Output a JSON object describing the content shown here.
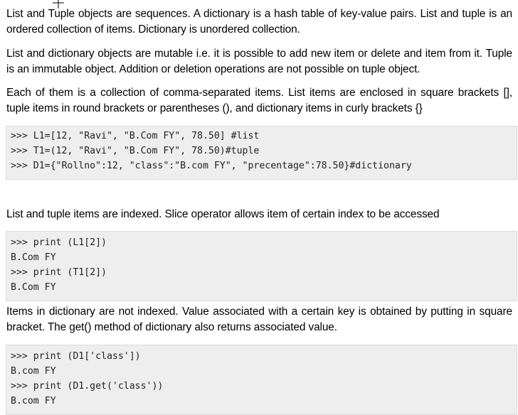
{
  "paragraphs": [
    "List and Tuple objects are sequences. A dictionary is a hash table of key-value pairs. List and tuple is an ordered collection of items. Dictionary is unordered collection.",
    "List and dictionary objects are mutable i.e. it is possible to add new item or delete and item from it. Tuple is an immutable object. Addition or deletion operations are not possible on tuple object.",
    "Each of them is a collection of comma-separated items. List items are enclosed in square brackets [], tuple items in round brackets or parentheses (), and dictionary items in curly brackets {}",
    "List and tuple items are indexed. Slice operator allows item of certain index to be accessed",
    "Items in dictionary are not indexed. Value associated with a certain key is obtained by putting in square bracket. The get() method of dictionary also returns associated value."
  ],
  "code_blocks": [
    ">>> L1=[12, \"Ravi\", \"B.Com FY\", 78.50] #list\n>>> T1=(12, \"Ravi\", \"B.Com FY\", 78.50)#tuple\n>>> D1={\"Rollno\":12, \"class\":\"B.com FY\", \"precentage\":78.50}#dictionary",
    ">>> print (L1[2])\nB.Com FY\n>>> print (T1[2])\nB.Com FY",
    ">>> print (D1['class'])\nB.com FY\n>>> print (D1.get('class'))\nB.com FY"
  ],
  "icons": {
    "cursor": "crosshair-cursor-icon"
  }
}
